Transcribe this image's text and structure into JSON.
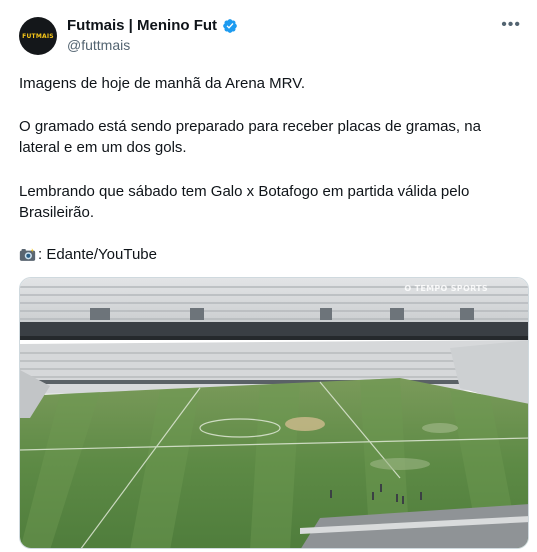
{
  "author": {
    "name": "Futmais | Menino Fut",
    "handle": "@futtmais",
    "avatar_text": "FUTMAIS",
    "verified": true
  },
  "tweet": {
    "paragraph_1": "Imagens de hoje de manhã da Arena MRV.",
    "paragraph_2": "O gramado está sendo preparado para receber placas de gramas, na lateral e em um dos gols.",
    "paragraph_3": "Lembrando que sábado tem Galo x Botafogo em partida válida pelo Brasileirão.",
    "credit": ": Edante/YouTube"
  },
  "media": {
    "watermark": "O TEMPO SPORTS"
  },
  "colors": {
    "verified_blue": "#1d9bf0",
    "text": "#0f1419",
    "secondary": "#536471"
  },
  "icons": {
    "more": "more-icon",
    "verified": "verified-badge-icon",
    "camera": "camera-flash-icon"
  }
}
